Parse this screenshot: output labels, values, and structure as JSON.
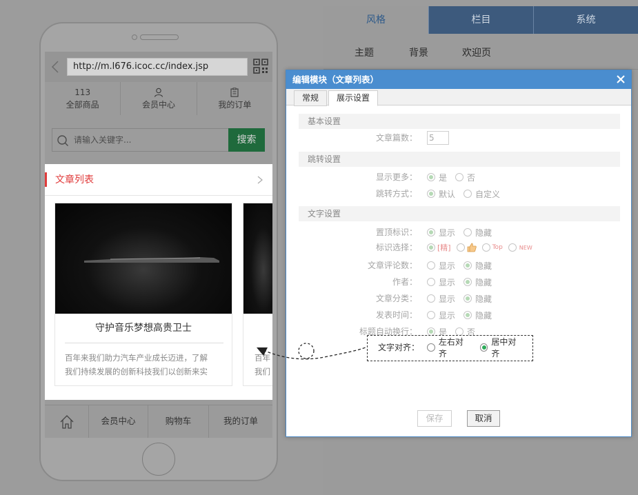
{
  "phone": {
    "url": "http://m.l676.icoc.cc/index.jsp",
    "nav": [
      {
        "top": "113",
        "label": "全部商品"
      },
      {
        "top": "",
        "label": "会员中心",
        "icon": "user-icon"
      },
      {
        "top": "",
        "label": "我的订单",
        "icon": "order-icon"
      }
    ],
    "search": {
      "placeholder": "请输入关键字...",
      "button": "搜索"
    },
    "article_list": {
      "title": "文章列表",
      "cards": [
        {
          "title": "守护音乐梦想高贵卫士",
          "desc_line1": "百年来我们助力汽车产业成长迈进，了解",
          "desc_line2": "我们持续发展的创新科技我们以创新来实"
        },
        {
          "title": "",
          "desc_line1": "百年",
          "desc_line2": "我们"
        }
      ]
    },
    "bottom_nav": [
      "会员中心",
      "购物车",
      "我的订单"
    ]
  },
  "settings": {
    "tabs": [
      "风格",
      "栏目",
      "系统"
    ],
    "subtabs": [
      "主题",
      "背景",
      "欢迎页"
    ]
  },
  "modal": {
    "title": "编辑模块（文章列表）",
    "tabs": [
      "常规",
      "展示设置"
    ],
    "sections": {
      "basic": "基本设置",
      "jump": "跳转设置",
      "text": "文字设置"
    },
    "rows": {
      "article_count": {
        "label": "文章篇数：",
        "value": "5"
      },
      "show_more": {
        "label": "显示更多：",
        "yes": "是",
        "no": "否"
      },
      "jump_mode": {
        "label": "跳转方式：",
        "default": "默认",
        "custom": "自定义"
      },
      "top_mark": {
        "label": "置顶标识：",
        "show": "显示",
        "hide": "隐藏"
      },
      "mark_select": {
        "label": "标识选择：",
        "tag1": "[精]",
        "tag3": "Top",
        "tag4": "NEW"
      },
      "comments": {
        "label": "文章评论数：",
        "show": "显示",
        "hide": "隐藏"
      },
      "author": {
        "label": "作者：",
        "show": "显示",
        "hide": "隐藏"
      },
      "category": {
        "label": "文章分类：",
        "show": "显示",
        "hide": "隐藏"
      },
      "publish_time": {
        "label": "发表时间：",
        "show": "显示",
        "hide": "隐藏"
      },
      "auto_wrap": {
        "label": "标题自动换行：",
        "yes": "是",
        "no": "否"
      },
      "align": {
        "label": "文字对齐：",
        "left": "左右对齐",
        "center": "居中对齐"
      }
    },
    "buttons": {
      "save": "保存",
      "cancel": "取消"
    }
  },
  "colors": {
    "accent": "#4a8dcf",
    "search_btn": "#1f6a3c",
    "article_title": "#e03b3b",
    "radio_selected": "#2eab5a"
  }
}
